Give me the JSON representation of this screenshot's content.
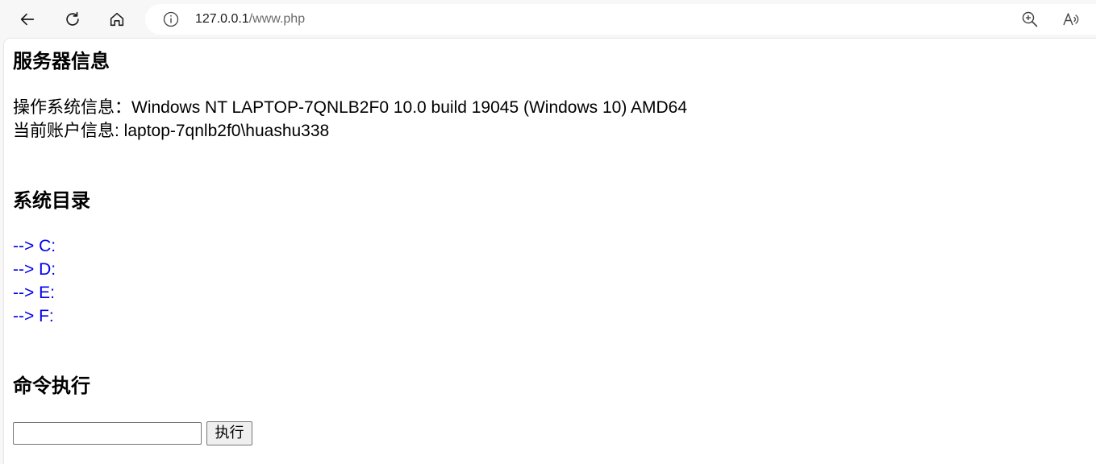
{
  "browser": {
    "address_host": "127.0.0.1",
    "address_path": "/www.php",
    "icons": [
      "back-icon",
      "refresh-icon",
      "home-icon",
      "info-icon",
      "zoom-icon",
      "read-aloud-icon"
    ]
  },
  "server_info": {
    "heading": "服务器信息",
    "os_line": "操作系统信息：Windows NT LAPTOP-7QNLB2F0 10.0 build 19045 (Windows 10) AMD64",
    "user_line": "当前账户信息: laptop-7qnlb2f0\\huashu338"
  },
  "directories": {
    "heading": "系统目录",
    "items": [
      {
        "label": "--> C:"
      },
      {
        "label": "--> D:"
      },
      {
        "label": "--> E:"
      },
      {
        "label": "--> F:"
      }
    ]
  },
  "command": {
    "heading": "命令执行",
    "input_value": "",
    "button_label": "执行"
  },
  "colors": {
    "link": "#0000ee",
    "browser_chrome": "#f7f7f7",
    "page_bg": "#ffffff"
  }
}
